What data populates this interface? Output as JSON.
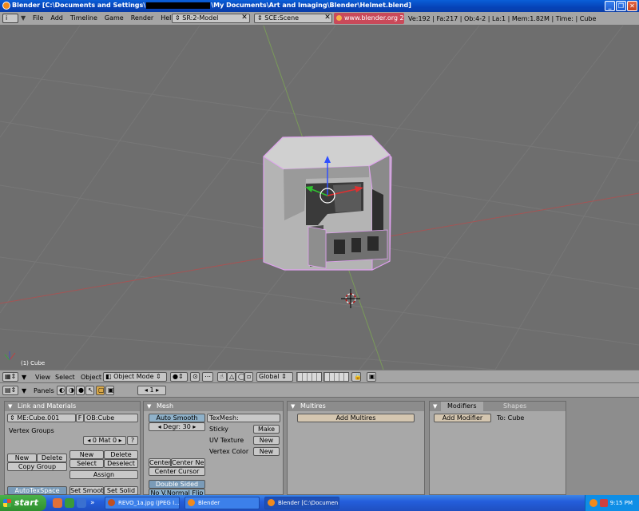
{
  "window": {
    "title_prefix": "Blender [C:\\Documents and Settings\\",
    "title_suffix": "\\My Documents\\Art and Imaging\\Blender\\Helmet.blend]",
    "buttons": [
      "_",
      "❐",
      "✕"
    ]
  },
  "info_header": {
    "window_type": "i",
    "menus": [
      "File",
      "Add",
      "Timeline",
      "Game",
      "Render",
      "Help"
    ],
    "screen": "SR:2-Model",
    "scene": "SCE:Scene",
    "url": "www.blender.org 245",
    "stats": "Ve:192 | Fa:217 | Ob:4-2 | La:1  | Mem:1.82M  | Time: | Cube"
  },
  "viewport": {
    "object_label": "(1) Cube",
    "colors": {
      "background": "#6e6e6e",
      "grid": "#777777",
      "x_axis": "#a55454",
      "z_axis": "#7a9a5a"
    }
  },
  "view_header": {
    "menus": [
      "View",
      "Select",
      "Object"
    ],
    "mode": "Object Mode",
    "orientation": "Global"
  },
  "buttons_header": {
    "panels_label": "Panels",
    "frame": "1"
  },
  "link_materials": {
    "title": "Link and Materials",
    "mesh_name": "ME:Cube.001",
    "f_label": "F",
    "object_name": "OB:Cube",
    "vertex_groups": "Vertex Groups",
    "mat_index": "0 Mat 0",
    "question": "?",
    "new1": "New",
    "delete1": "Delete",
    "copy_group": "Copy Group",
    "new2": "New",
    "delete2": "Delete",
    "select": "Select",
    "deselect": "Deselect",
    "assign": "Assign",
    "autotexspace": "AutoTexSpace",
    "set_smooth": "Set Smooth",
    "set_solid": "Set Solid"
  },
  "mesh": {
    "title": "Mesh",
    "auto_smooth": "Auto Smooth",
    "degr": "Degr: 30",
    "texmesh": "TexMesh:",
    "sticky": "Sticky",
    "make": "Make",
    "uv_texture": "UV Texture",
    "new_uv": "New",
    "vertex_color": "Vertex Color",
    "new_vc": "New",
    "center": "Center",
    "center_new": "Center New",
    "center_cursor": "Center Cursor",
    "double_sided": "Double Sided",
    "no_v_normal_flip": "No V.Normal Flip"
  },
  "multires": {
    "title": "Multires",
    "add_multires": "Add Multires"
  },
  "modifiers": {
    "tab_modifiers": "Modifiers",
    "tab_shapes": "Shapes",
    "add_modifier": "Add Modifier",
    "to_label": "To: Cube"
  },
  "taskbar": {
    "start": "start",
    "tasks": [
      "REVO_1a.jpg (JPEG I...",
      "Blender",
      "Blender [C:\\Documen..."
    ],
    "clock": "9:15 PM"
  }
}
